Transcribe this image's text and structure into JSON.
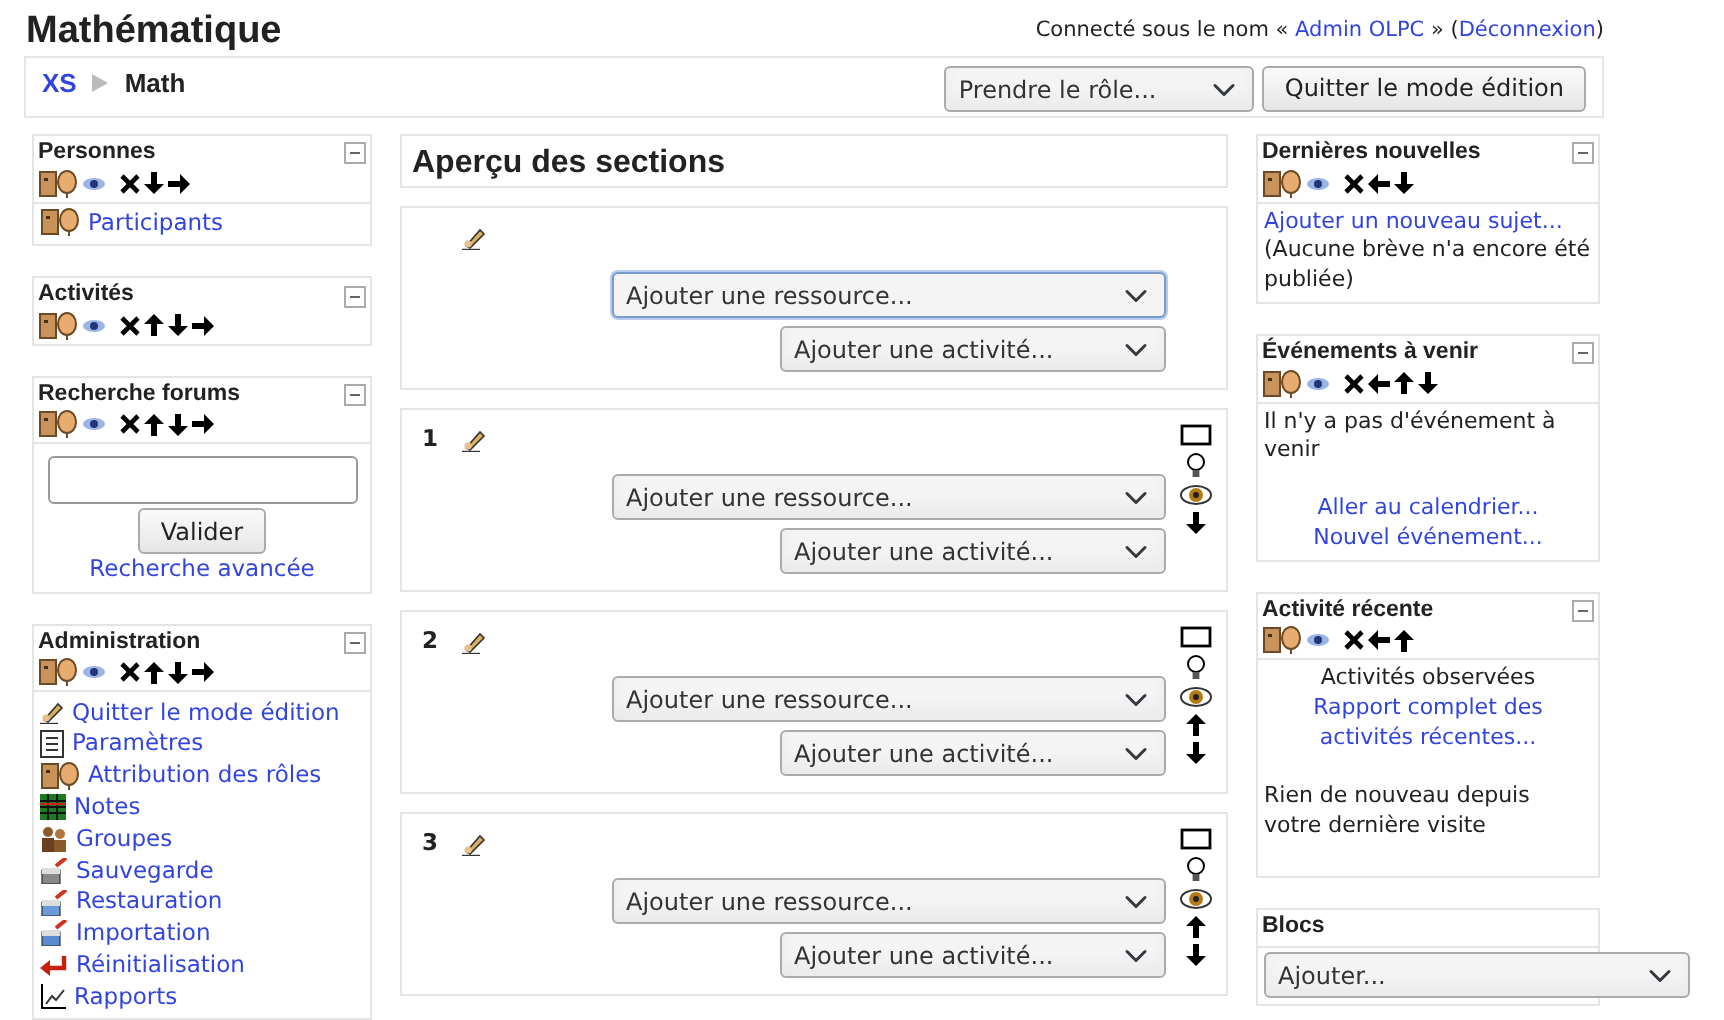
{
  "header": {
    "title": "Mathématique",
    "login": {
      "prefix": "Connecté sous le nom « ",
      "user": "Admin OLPC",
      "middle": " » (",
      "logout": "Déconnexion",
      "suffix": ")"
    }
  },
  "breadcrumb": [
    {
      "label": "XS",
      "link": true
    },
    {
      "label": "Math",
      "link": false
    }
  ],
  "role_select": "Prendre le rôle...",
  "edit_button": "Quitter le mode édition",
  "left_blocks": [
    {
      "title": "Personnes",
      "collapsible": true,
      "controls": [
        {
          "kind": "roles"
        },
        {
          "kind": "hide"
        },
        {
          "kind": "delete"
        },
        {
          "kind": "down"
        },
        {
          "kind": "right"
        }
      ],
      "content": [
        {
          "kind": "participants",
          "text": "Participants"
        }
      ]
    },
    {
      "title": "Activités",
      "collapsible": true,
      "controls": [
        {
          "kind": "roles"
        },
        {
          "kind": "hide"
        },
        {
          "kind": "delete"
        },
        {
          "kind": "up"
        },
        {
          "kind": "down"
        },
        {
          "kind": "right"
        }
      ]
    },
    {
      "title": "Recherche forums",
      "collapsible": true,
      "controls": [
        {
          "kind": "roles"
        },
        {
          "kind": "hide"
        },
        {
          "kind": "delete"
        },
        {
          "kind": "up"
        },
        {
          "kind": "down"
        },
        {
          "kind": "right"
        }
      ],
      "content": [
        {
          "kind": "field"
        },
        {
          "kind": "button",
          "text": "Valider"
        },
        {
          "kind": "center_link",
          "text": "Recherche avancée"
        }
      ]
    },
    {
      "title": "Administration",
      "collapsible": true,
      "controls": [
        {
          "kind": "roles"
        },
        {
          "kind": "hide"
        },
        {
          "kind": "delete"
        },
        {
          "kind": "up"
        },
        {
          "kind": "down"
        },
        {
          "kind": "right"
        }
      ],
      "content": [
        {
          "kind": "editing",
          "text": "Quitter le mode édition"
        },
        {
          "kind": "settings",
          "text": "Paramètres"
        },
        {
          "kind": "roles",
          "text": "Attribution des rôles"
        },
        {
          "kind": "grades",
          "text": "Notes"
        },
        {
          "kind": "groups",
          "text": "Groupes"
        },
        {
          "kind": "backup",
          "text": "Sauvegarde"
        },
        {
          "kind": "restore",
          "text": "Restauration"
        },
        {
          "kind": "import",
          "text": "Importation"
        },
        {
          "kind": "reset",
          "text": "Réinitialisation"
        },
        {
          "kind": "reports",
          "text": "Rapports"
        }
      ]
    }
  ],
  "center": {
    "title": "Aperçu des sections",
    "sections": [
      {
        "resource_select": "Ajouter une ressource...",
        "resource_focused": true,
        "activity_select": "Ajouter une activité..."
      },
      {
        "number": "1",
        "resource_select": "Ajouter une ressource...",
        "resource_focused": false,
        "activity_select": "Ajouter une activité...",
        "tools": [
          {
            "kind": "highlight"
          },
          {
            "kind": "bulb"
          },
          {
            "kind": "visible"
          },
          {
            "kind": "down"
          }
        ]
      },
      {
        "number": "2",
        "resource_select": "Ajouter une ressource...",
        "resource_focused": false,
        "activity_select": "Ajouter une activité...",
        "tools": [
          {
            "kind": "highlight"
          },
          {
            "kind": "bulb"
          },
          {
            "kind": "visible"
          },
          {
            "kind": "up"
          },
          {
            "kind": "down"
          }
        ]
      },
      {
        "number": "3",
        "resource_select": "Ajouter une ressource...",
        "resource_focused": false,
        "activity_select": "Ajouter une activité...",
        "tools": [
          {
            "kind": "highlight"
          },
          {
            "kind": "bulb"
          },
          {
            "kind": "visible"
          },
          {
            "kind": "up"
          },
          {
            "kind": "down"
          }
        ]
      }
    ]
  },
  "right_blocks": [
    {
      "title": "Dernières nouvelles",
      "collapsible": true,
      "controls": [
        {
          "kind": "roles"
        },
        {
          "kind": "hide"
        },
        {
          "kind": "delete"
        },
        {
          "kind": "left"
        },
        {
          "kind": "down"
        }
      ],
      "content": [
        {
          "kind": "link",
          "text": "Ajouter un nouveau sujet..."
        },
        {
          "kind": "text",
          "text": "(Aucune brève n'a encore été publiée)"
        }
      ]
    },
    {
      "title": "Événements à venir",
      "collapsible": true,
      "controls": [
        {
          "kind": "roles"
        },
        {
          "kind": "hide"
        },
        {
          "kind": "delete"
        },
        {
          "kind": "left"
        },
        {
          "kind": "up"
        },
        {
          "kind": "down"
        }
      ],
      "content": [
        {
          "kind": "text",
          "text": "Il n'y a pas d'événement à venir"
        },
        {
          "kind": "spacer"
        },
        {
          "kind": "center_link",
          "text": "Aller au calendrier..."
        },
        {
          "kind": "center_link",
          "text": "Nouvel événement..."
        }
      ]
    },
    {
      "title": "Activité récente",
      "collapsible": true,
      "controls": [
        {
          "kind": "roles"
        },
        {
          "kind": "hide"
        },
        {
          "kind": "delete"
        },
        {
          "kind": "left"
        },
        {
          "kind": "up"
        }
      ],
      "content": [
        {
          "kind": "center_text",
          "text": "Activités observées"
        },
        {
          "kind": "center_link",
          "text": "Rapport complet des activités récentes..."
        },
        {
          "kind": "spacer"
        },
        {
          "kind": "text",
          "text": "Rien de nouveau depuis votre dernière visite"
        },
        {
          "kind": "spacer"
        }
      ]
    },
    {
      "title": "Blocs",
      "collapsible": false,
      "content": [
        {
          "kind": "select",
          "text": "Ajouter..."
        }
      ]
    }
  ]
}
